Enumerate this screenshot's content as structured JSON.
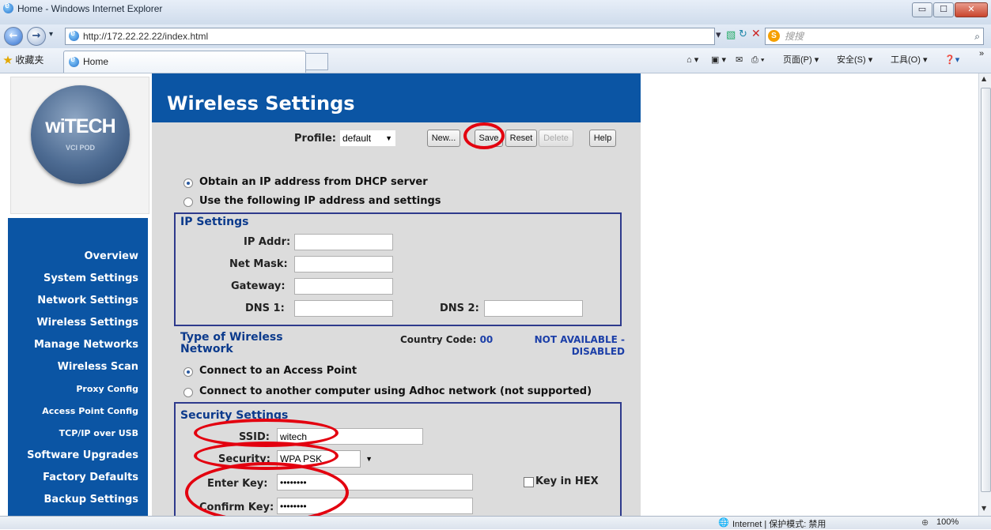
{
  "window": {
    "title": "Home - Windows Internet Explorer"
  },
  "toolbar": {
    "url": "http://172.22.22.22/index.html",
    "search_placeholder": "搜搜",
    "favorites": "收藏夹",
    "tab_label": "Home",
    "page_menu": "页面(P) ▾",
    "safety_menu": "安全(S) ▾",
    "tools_menu": "工具(O) ▾"
  },
  "statusbar": {
    "zone": "Internet | 保护模式: 禁用",
    "zoom": "100%"
  },
  "logo": {
    "text": "wiTECH",
    "sub": "VCI POD"
  },
  "sidebar": {
    "items": [
      {
        "label": "Overview"
      },
      {
        "label": "System Settings"
      },
      {
        "label": "Network Settings"
      },
      {
        "label": "Wireless Settings"
      },
      {
        "label": "Manage Networks"
      },
      {
        "label": "Wireless Scan"
      },
      {
        "label": "Proxy Config"
      },
      {
        "label": "Access Point Config"
      },
      {
        "label": "TCP/IP over USB"
      },
      {
        "label": "Software Upgrades"
      },
      {
        "label": "Factory Defaults"
      },
      {
        "label": "Backup Settings"
      }
    ]
  },
  "main": {
    "title": "Wireless Settings",
    "profile_label": "Profile:",
    "profile_value": "default",
    "buttons": {
      "new": "New...",
      "save": "Save",
      "reset": "Reset",
      "delete": "Delete",
      "help": "Help"
    },
    "dhcp_option": "Obtain an IP address from DHCP server",
    "static_option": "Use the following IP address and settings",
    "ip_settings": {
      "title": "IP Settings",
      "ip_label": "IP Addr:",
      "mask_label": "Net Mask:",
      "gateway_label": "Gateway:",
      "dns1_label": "DNS 1:",
      "dns2_label": "DNS 2:"
    },
    "network_type": {
      "title_line1": "Type of Wireless",
      "title_line2": "Network",
      "country_label": "Country Code:",
      "country_value": "00",
      "status_line1": "NOT AVAILABLE -",
      "status_line2": "DISABLED",
      "ap_option": "Connect to an Access Point",
      "adhoc_option": "Connect to another computer using Adhoc network (not supported)"
    },
    "security": {
      "title": "Security Settings",
      "ssid_label": "SSID:",
      "ssid_value": "witech",
      "security_label": "Security:",
      "security_value": "WPA PSK",
      "key_label": "Enter Key:",
      "key_value": "••••••••",
      "confirm_label": "Confirm Key:",
      "confirm_value": "••••••••",
      "hex_label": "Key in HEX"
    }
  },
  "colors": {
    "brand_blue": "#0b55a4",
    "highlight_red": "#e3000f",
    "panel_gray": "#dcdcdc"
  }
}
